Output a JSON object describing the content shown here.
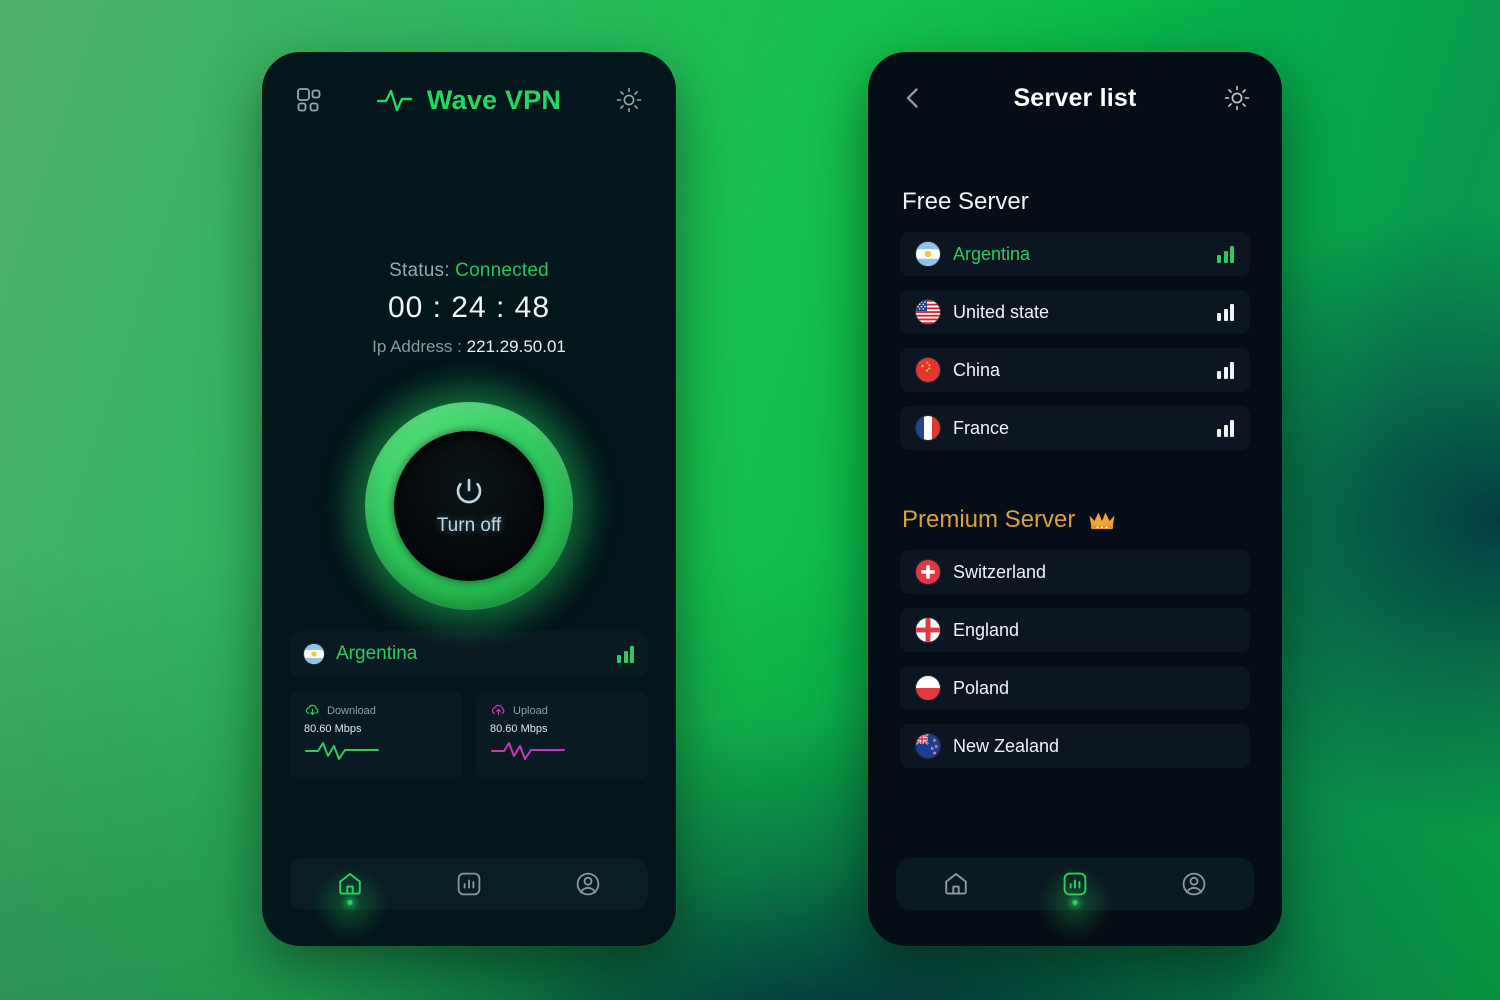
{
  "theme": {
    "accent_green": "#2fc95f",
    "bright_green": "#23d862",
    "premium_gold": "#d9a13c",
    "upload_magenta": "#c738b8",
    "phone_bg": "#02161c",
    "card_bg": "#0b1622"
  },
  "home": {
    "header": {
      "grid_icon": "grid-dashboard-icon",
      "logo_icon": "pulse-wave-icon",
      "brand": "Wave VPN",
      "theme_icon": "sun-brightness-icon"
    },
    "status": {
      "label": "Status:",
      "value": "Connected",
      "timer": "00 : 24 : 48",
      "ip_label": "Ip Address :",
      "ip_value": "221.29.50.01"
    },
    "power": {
      "icon": "power-icon",
      "label": "Turn off"
    },
    "current_server": {
      "flag": "flag-argentina",
      "name": "Argentina",
      "signal_icon": "signal-bars-icon",
      "signal_strength": 3
    },
    "speeds": [
      {
        "icon": "cloud-download-icon",
        "label": "Download",
        "value": "80.60 Mbps",
        "color": "#2fc95f",
        "wave_icon": "waveform-icon"
      },
      {
        "icon": "cloud-upload-icon",
        "label": "Upload",
        "value": "80.60 Mbps",
        "color": "#c738b8",
        "wave_icon": "waveform-icon"
      }
    ],
    "nav": [
      {
        "icon": "home-icon",
        "active": true
      },
      {
        "icon": "stats-chart-icon",
        "active": false
      },
      {
        "icon": "profile-account-icon",
        "active": false
      }
    ]
  },
  "server_list": {
    "header": {
      "back_icon": "chevron-left-icon",
      "title": "Server list",
      "theme_icon": "sun-brightness-icon"
    },
    "free_section": {
      "title": "Free Server",
      "servers": [
        {
          "name": "Argentina",
          "flag": "flag-argentina",
          "selected": true,
          "signal_icon": "signal-bars-icon"
        },
        {
          "name": "United state",
          "flag": "flag-usa",
          "selected": false,
          "signal_icon": "signal-bars-icon"
        },
        {
          "name": "China",
          "flag": "flag-china",
          "selected": false,
          "signal_icon": "signal-bars-icon"
        },
        {
          "name": "France",
          "flag": "flag-france",
          "selected": false,
          "signal_icon": "signal-bars-icon"
        }
      ]
    },
    "premium_section": {
      "title": "Premium Server",
      "badge_icon": "crown-icon",
      "servers": [
        {
          "name": "Switzerland",
          "flag": "flag-switzerland",
          "selected": false
        },
        {
          "name": "England",
          "flag": "flag-england",
          "selected": false
        },
        {
          "name": "Poland",
          "flag": "flag-poland",
          "selected": false
        },
        {
          "name": "New Zealand",
          "flag": "flag-newzealand",
          "selected": false
        }
      ]
    },
    "nav": [
      {
        "icon": "home-icon",
        "active": false
      },
      {
        "icon": "stats-chart-icon",
        "active": true
      },
      {
        "icon": "profile-account-icon",
        "active": false
      }
    ]
  }
}
